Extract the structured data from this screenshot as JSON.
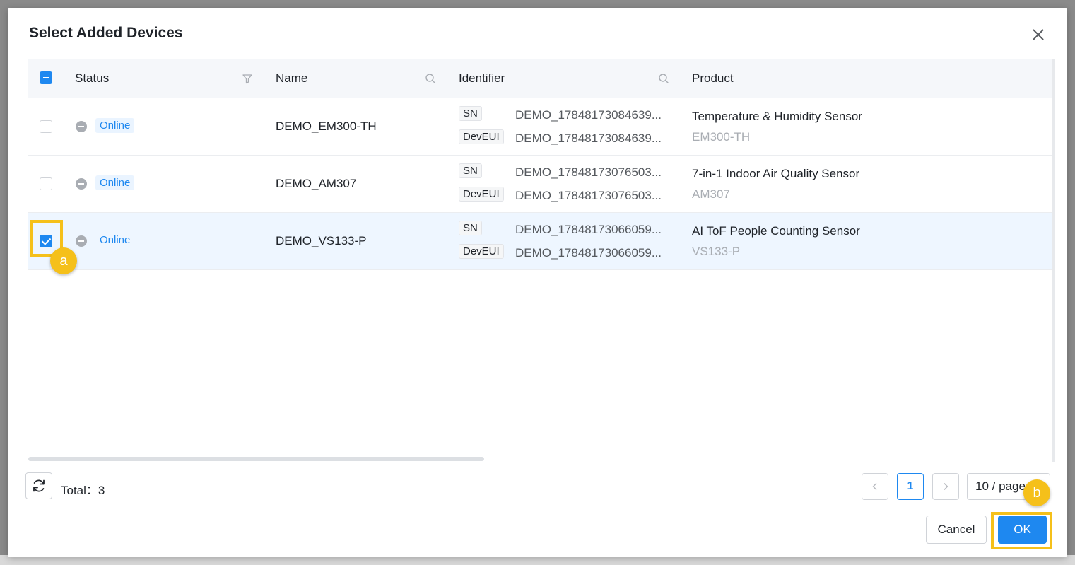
{
  "dialog": {
    "title": "Select Added Devices"
  },
  "table": {
    "columns": [
      "Status",
      "Name",
      "Identifier",
      "Product"
    ],
    "rows": [
      {
        "status": "Online",
        "name": "DEMO_EM300-TH",
        "sn_tag": "SN",
        "sn": "DEMO_17848173084639...",
        "deveui_tag": "DevEUI",
        "deveui": "DEMO_17848173084639...",
        "product_name": "Temperature & Humidity Sensor",
        "product_model": "EM300-TH",
        "selected": false
      },
      {
        "status": "Online",
        "name": "DEMO_AM307",
        "sn_tag": "SN",
        "sn": "DEMO_17848173076503...",
        "deveui_tag": "DevEUI",
        "deveui": "DEMO_17848173076503...",
        "product_name": "7-in-1 Indoor Air Quality Sensor",
        "product_model": "AM307",
        "selected": false
      },
      {
        "status": "Online",
        "name": "DEMO_VS133-P",
        "sn_tag": "SN",
        "sn": "DEMO_17848173066059...",
        "deveui_tag": "DevEUI",
        "deveui": "DEMO_17848173066059...",
        "product_name": "AI ToF People Counting Sensor",
        "product_model": "VS133-P",
        "selected": true
      }
    ]
  },
  "footer": {
    "total": "Total：3",
    "current_page": "1",
    "page_size": "10 / page",
    "cancel_label": "Cancel",
    "ok_label": "OK"
  },
  "annotations": {
    "a": "a",
    "b": "b"
  },
  "colors": {
    "primary": "#1e88f0",
    "highlight": "#f5c01a",
    "status_online_bg": "#eaf4ff"
  },
  "icons": [
    "close-icon",
    "filter-icon",
    "search-icon",
    "refresh-icon",
    "chevron-left-icon",
    "chevron-right-icon",
    "status-minus-icon"
  ]
}
